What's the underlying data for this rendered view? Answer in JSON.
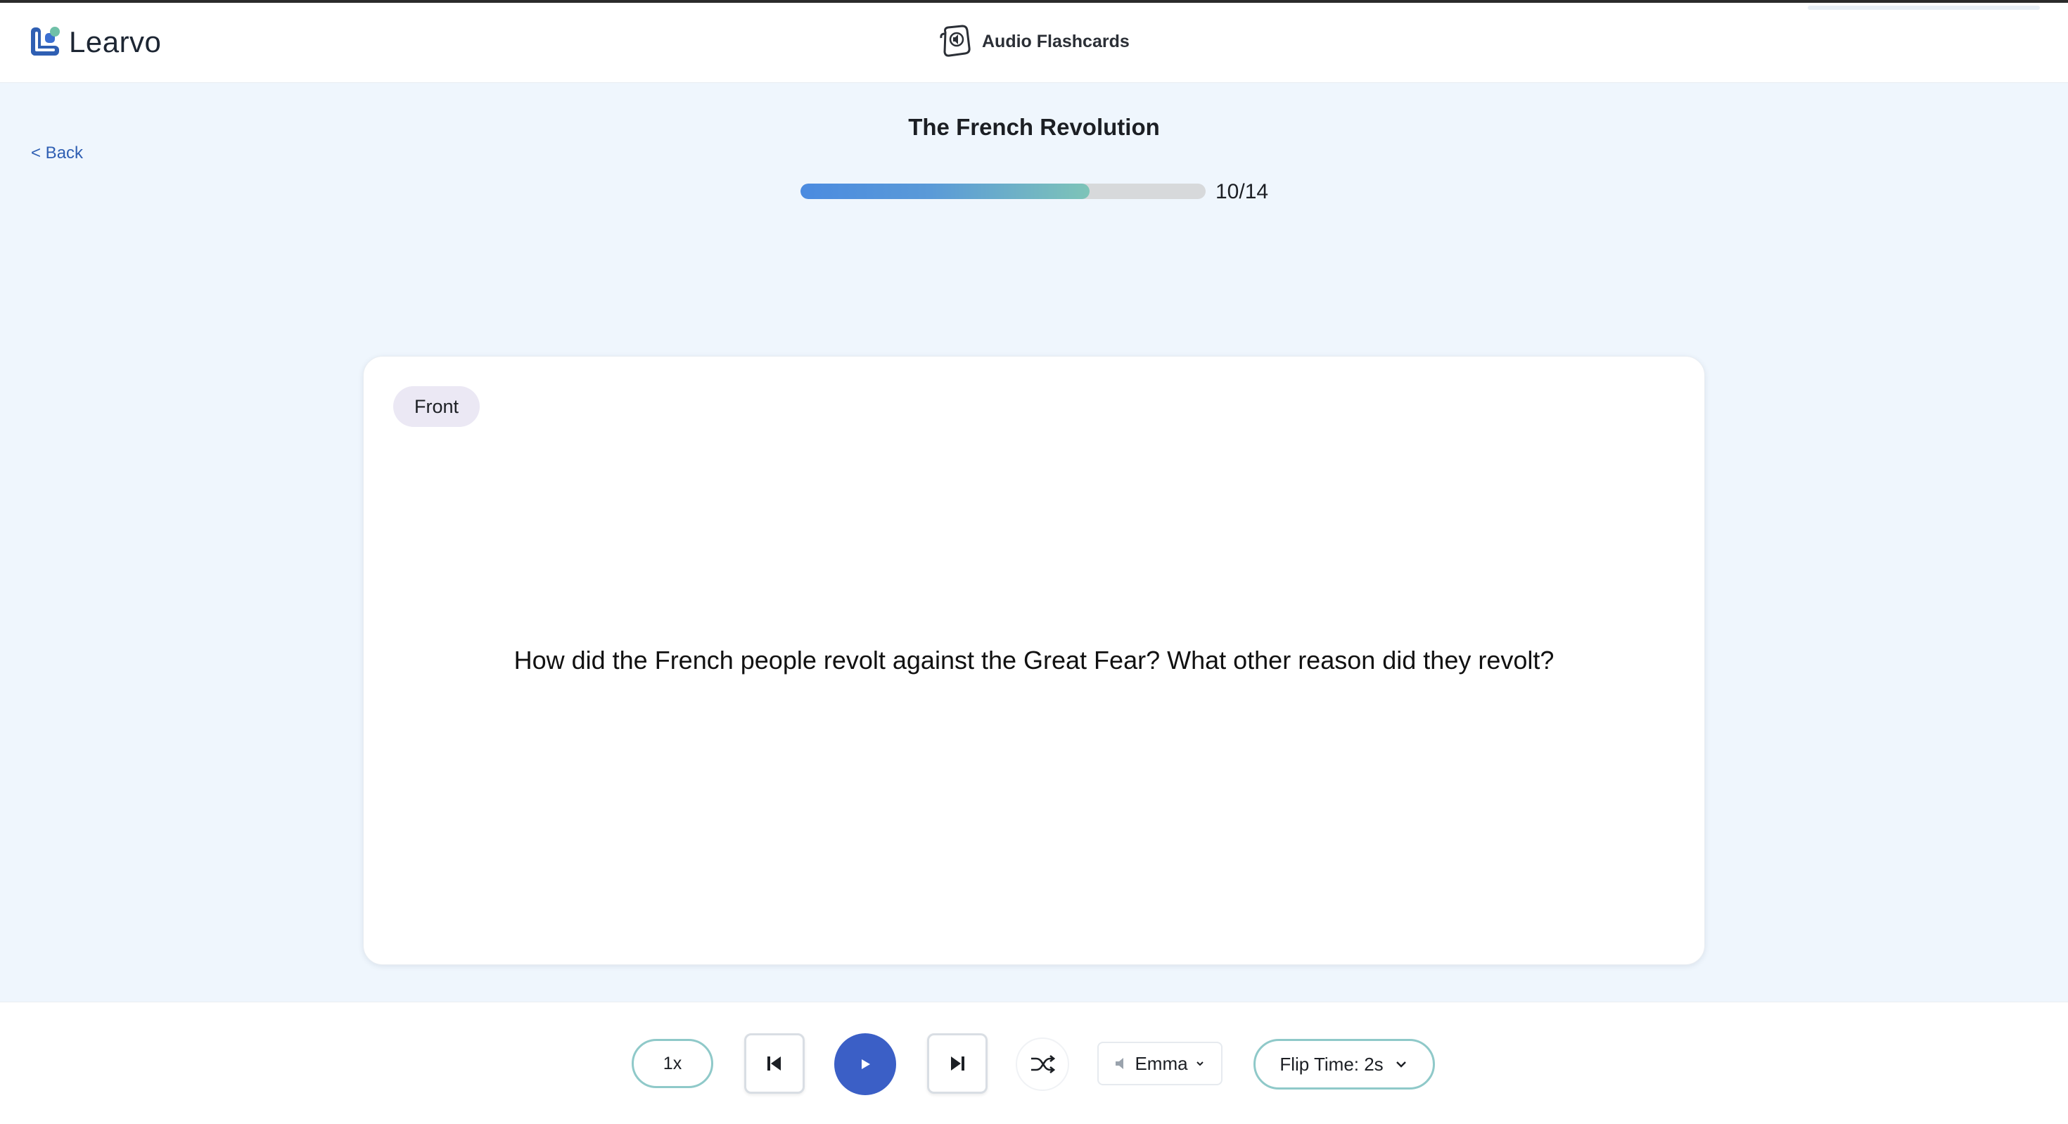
{
  "header": {
    "brand": "Learvo",
    "app_title": "Audio Flashcards"
  },
  "nav": {
    "back_label": "< Back"
  },
  "deck": {
    "title": "The French Revolution",
    "progress": {
      "current": 10,
      "total": 14,
      "fraction": 0.714,
      "label": "10/14"
    }
  },
  "card": {
    "side_label": "Front",
    "text": "How did the French people revolt against the Great Fear? What other reason did they revolt?"
  },
  "controls": {
    "speed_label": "1x",
    "voice_label": "Emma",
    "flip_time_label": "Flip Time: 2s"
  },
  "colors": {
    "accent": "#3b5fc6",
    "progress_start": "#4b8be0",
    "progress_end": "#7ec4b8",
    "outline_teal": "#8fc9c9",
    "link": "#2f5fb3"
  }
}
